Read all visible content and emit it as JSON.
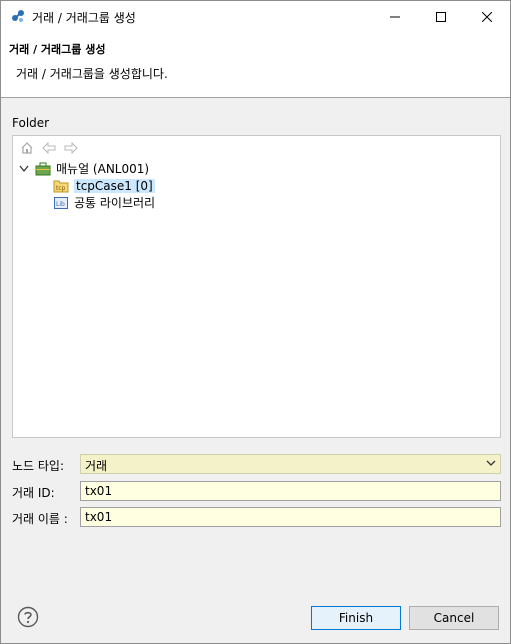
{
  "window": {
    "title": "거래 / 거래그룹 생성"
  },
  "header": {
    "title": "거래 / 거래그룹 생성",
    "description": "거래 / 거래그룹을 생성합니다."
  },
  "folder": {
    "label": "Folder",
    "tree": {
      "root": {
        "label": "매뉴얼  (ANL001)",
        "expanded": true,
        "icon": "briefcase-icon"
      },
      "children": [
        {
          "label": "tcpCase1 [0]",
          "selected": true,
          "icon": "folder-tcp-icon"
        },
        {
          "label": "공통 라이브러리",
          "selected": false,
          "icon": "library-icon"
        }
      ]
    }
  },
  "form": {
    "node_type": {
      "label": "노드 타입:",
      "value": "거래"
    },
    "id": {
      "label": "거래 ID:",
      "value": "tx01"
    },
    "name": {
      "label": "거래 이름  :",
      "value": "tx01"
    }
  },
  "buttons": {
    "finish": "Finish",
    "cancel": "Cancel"
  },
  "colors": {
    "selection": "#cce8ff",
    "field_bg": "#ffffe1",
    "accent": "#0078d7"
  }
}
